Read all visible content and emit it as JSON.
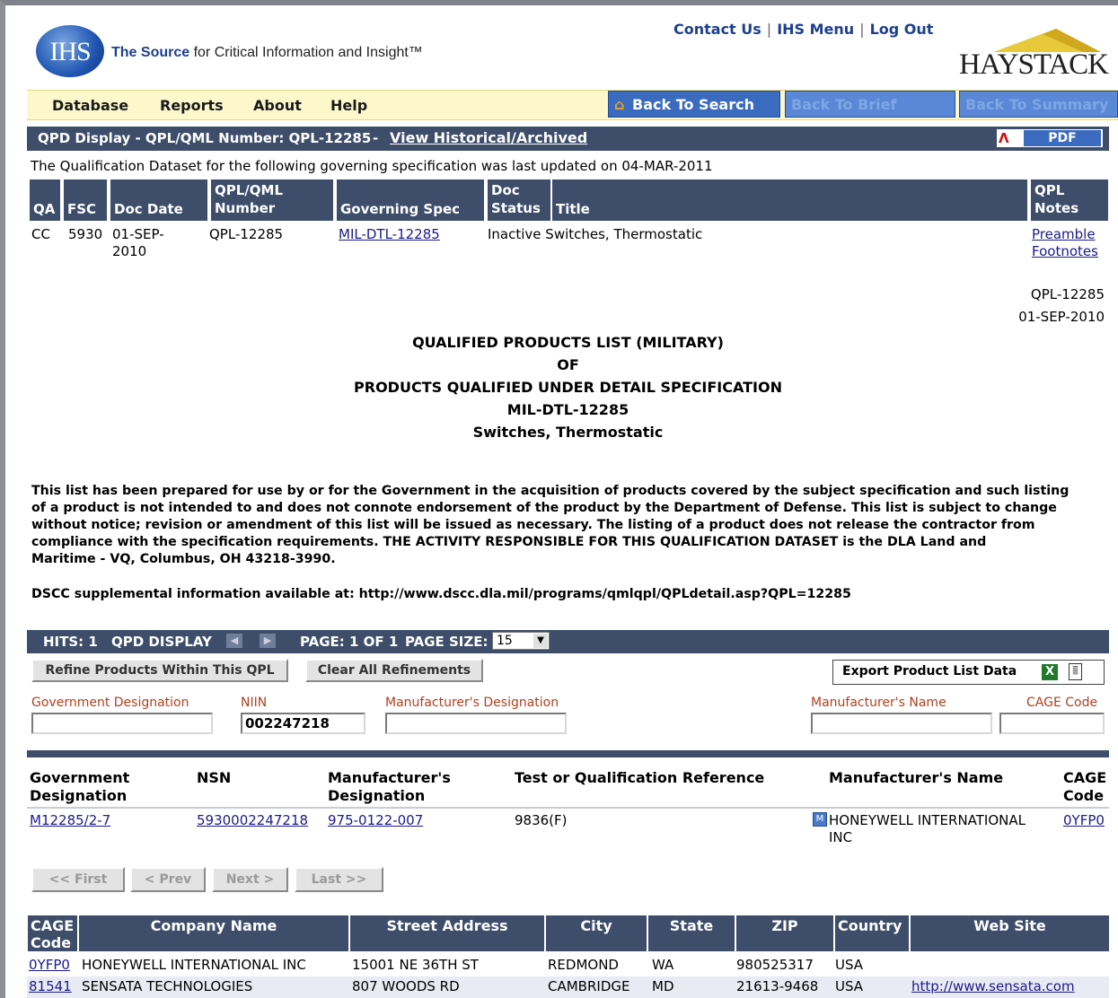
{
  "header": {
    "logo_text": "IHS",
    "tagline_brand": "The Source",
    "tagline_rest": " for Critical Information and Insight™",
    "links": [
      "Contact Us",
      "IHS Menu",
      "Log Out"
    ],
    "brand_logo": "HAYSTACK"
  },
  "nav": {
    "menu": [
      "Database",
      "Reports",
      "About",
      "Help"
    ],
    "back_to_search": "Back To Search",
    "back_to_brief": "Back To Brief",
    "back_to_summary": "Back To Summary"
  },
  "qpd_bar": {
    "title": "QPD Display - QPL/QML Number:  QPL-12285",
    "dash": "-",
    "historical_link": "View Historical/Archived",
    "pdf_label": "PDF"
  },
  "updated_note": "The Qualification Dataset for the following governing specification was last updated on 04-MAR-2011",
  "spec_table": {
    "headers": {
      "qa": "QA",
      "fsc": "FSC",
      "doc_date": "Doc Date",
      "qpl_line1": "QPL/QML",
      "qpl_line2": "Number",
      "gov_spec": "Governing Spec",
      "doc_status_line1": "Doc",
      "doc_status_line2": "Status",
      "title": "Title",
      "notes_line1": "QPL",
      "notes_line2": "Notes"
    },
    "row": {
      "qa": "CC",
      "fsc": "5930",
      "doc_date_line1": "01-SEP-",
      "doc_date_line2": "2010",
      "qpl": "QPL-12285",
      "gov_spec": "MIL-DTL-12285",
      "status_title": "Inactive Switches, Thermostatic",
      "preamble": "Preamble",
      "footnotes": "Footnotes"
    }
  },
  "doc": {
    "ref_number": "QPL-12285",
    "ref_date": "01-SEP-2010",
    "heading1": "QUALIFIED PRODUCTS LIST (MILITARY)",
    "heading2": "OF",
    "heading3": "PRODUCTS QUALIFIED UNDER DETAIL SPECIFICATION",
    "heading4": "MIL-DTL-12285",
    "heading5": "Switches, Thermostatic",
    "para_line1": "This list has been prepared for use by or for the Government in the acquisition of products covered by the subject specification and such listing",
    "para_line2": "of a product is not intended to and does not connote endorsement of the product by the Department of Defense. This list is subject to change",
    "para_line3": "without notice; revision or amendment of this list will be issued as necessary. The listing of a product does not release the contractor from",
    "para_line4": "compliance with the specification requirements. THE ACTIVITY RESPONSIBLE FOR THIS QUALIFICATION DATASET is the DLA Land and",
    "para_line5": "Maritime - VQ, Columbus, OH 43218-3990.",
    "dscc_line": "DSCC supplemental information available at: http://www.dscc.dla.mil/programs/qmlqpl/QPLdetail.asp?QPL=12285"
  },
  "results_bar": {
    "hits": "HITS: 1",
    "mode": "QPD DISPLAY",
    "page": "PAGE: 1 OF 1",
    "page_size_label": "PAGE SIZE:",
    "page_size_value": "15"
  },
  "filters": {
    "refine_button": "Refine Products Within This QPL",
    "clear_button": "Clear All Refinements",
    "export_button": "Export Product List Data",
    "gov_designation_label": "Government Designation",
    "gov_designation_value": "",
    "niin_label": "NIIN",
    "niin_value": "002247218",
    "mfr_designation_label": "Manufacturer's Designation",
    "mfr_designation_value": "",
    "mfr_name_label": "Manufacturer's Name",
    "mfr_name_value": "",
    "cage_label": "CAGE Code",
    "cage_value": ""
  },
  "products": {
    "headers": {
      "gov_line1": "Government",
      "gov_line2": "Designation",
      "nsn": "NSN",
      "mfr_line1": "Manufacturer's",
      "mfr_line2": "Designation",
      "test": "Test or Qualification Reference",
      "mfr_name": "Manufacturer's Name",
      "cage_line1": "CAGE",
      "cage_line2": "Code"
    },
    "rows": [
      {
        "gov": "M12285/2-7",
        "nsn": "5930002247218",
        "mfr_des": "975-0122-007",
        "test": "9836(F)",
        "mfr_name_line1": "HONEYWELL INTERNATIONAL",
        "mfr_name_line2": "INC",
        "cage": "0YFP0"
      }
    ]
  },
  "pager": {
    "first": "<< First",
    "prev": "< Prev",
    "next": "Next >",
    "last": "Last >>"
  },
  "companies": {
    "headers": {
      "cage_line1": "CAGE",
      "cage_line2": "Code",
      "name": "Company Name",
      "street": "Street Address",
      "city": "City",
      "state": "State",
      "zip": "ZIP",
      "country": "Country",
      "web": "Web Site"
    },
    "rows": [
      {
        "cage": "0YFP0",
        "name": "HONEYWELL INTERNATIONAL INC",
        "street": "15001 NE 36TH ST",
        "city": "REDMOND",
        "state": "WA",
        "zip": "980525317",
        "country": "USA",
        "web": ""
      },
      {
        "cage": "81541",
        "name": "SENSATA TECHNOLOGIES",
        "street": "807 WOODS RD",
        "city": "CAMBRIDGE",
        "state": "MD",
        "zip": "21613-9468",
        "country": "USA",
        "web": "http://www.sensata.com"
      }
    ]
  },
  "colors": {
    "bar": "#3d4d6a",
    "nav_bg": "#fdf8cc",
    "button_blue": "#3a6bbf",
    "link": "#1a1a8c",
    "label_red": "#b04020"
  }
}
